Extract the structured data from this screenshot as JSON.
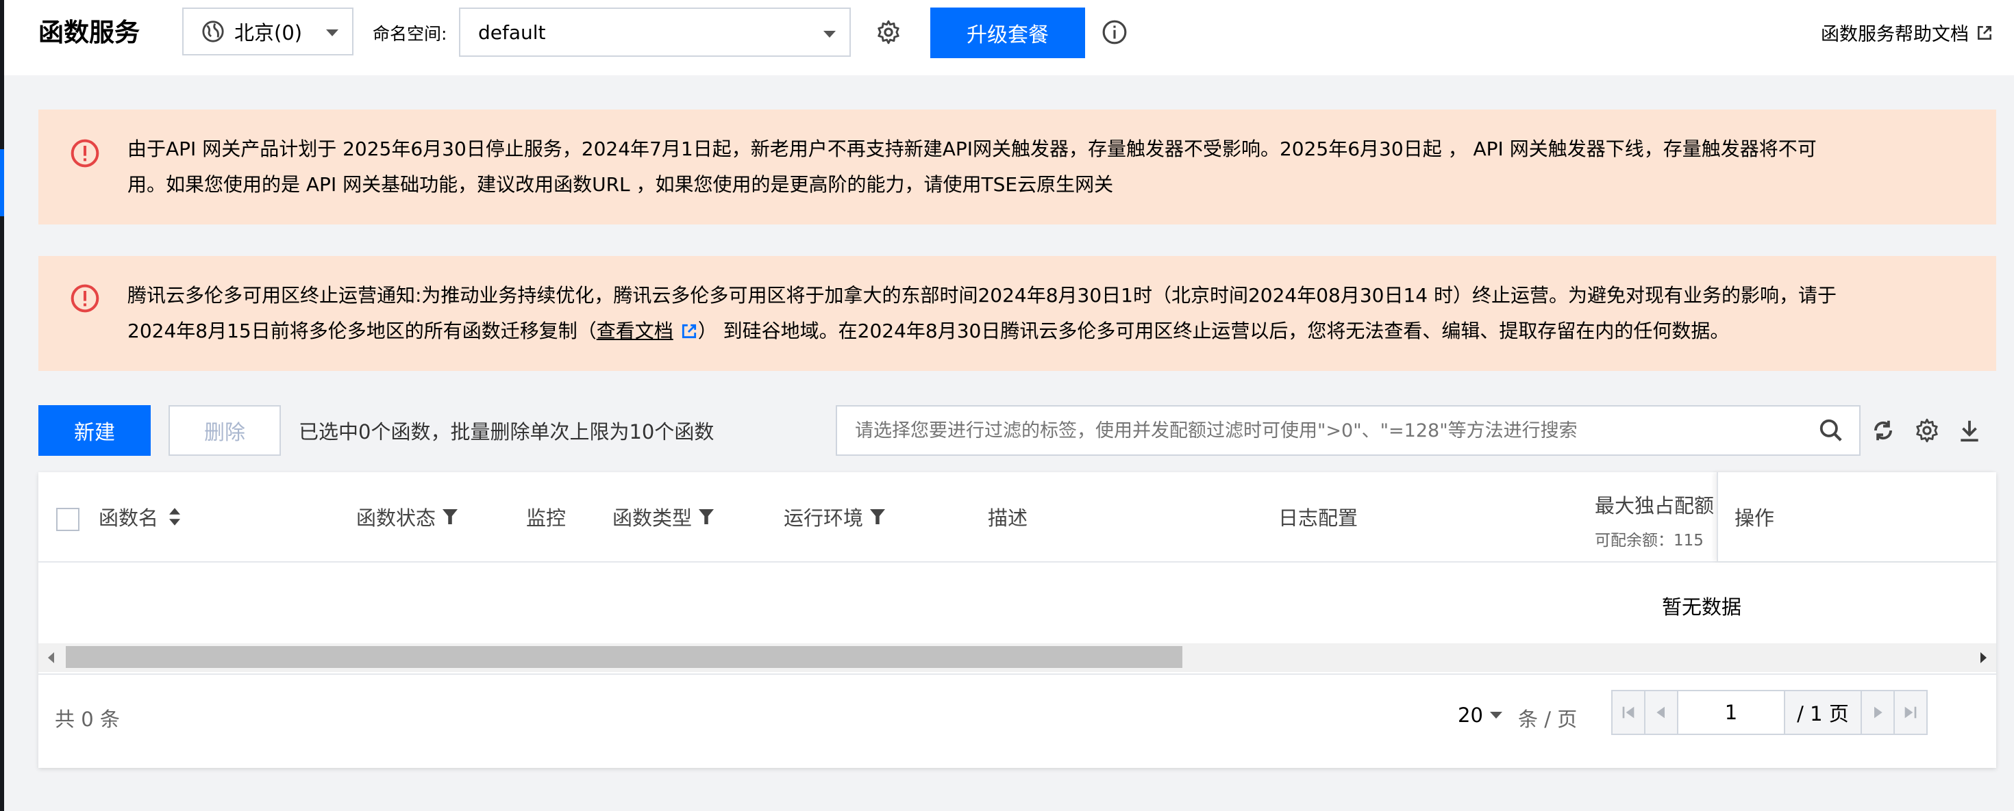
{
  "header": {
    "title": "函数服务",
    "region": "北京(0)",
    "namespace_label": "命名空间:",
    "namespace_value": "default",
    "upgrade_label": "升级套餐",
    "help_link": "函数服务帮助文档"
  },
  "notices": [
    {
      "line1": "由于API 网关产品计划于 2025年6月30日停止服务，2024年7月1日起，新老用户不再支持新建API网关触发器，存量触发器不受影响。2025年6月30日起 ， API 网关触发器下线，存量触发器将不可",
      "line2": "用。如果您使用的是 API 网关基础功能，建议改用函数URL ，如果您使用的是更高阶的能力，请使用TSE云原生网关"
    },
    {
      "line1": "腾讯云多伦多可用区终止运营通知:为推动业务持续优化，腾讯云多伦多可用区将于加拿大的东部时间2024年8月30日1时（北京时间2024年08月30日14 时）终止运营。为避免对现有业务的影响，请于",
      "line2_prefix": "2024年8月15日前将多伦多地区的所有函数迁移复制（",
      "link_text": "查看文档",
      "line2_suffix": "） 到硅谷地域。在2024年8月30日腾讯云多伦多可用区终止运营以后，您将无法查看、编辑、提取存留在内的任何数据。"
    }
  ],
  "toolbar": {
    "new_label": "新建",
    "delete_label": "删除",
    "selection_hint": "已选中0个函数，批量删除单次上限为10个函数",
    "search_placeholder": "请选择您要进行过滤的标签，使用并发配额过滤时可使用\">0\"、\"=128\"等方法进行搜索"
  },
  "table": {
    "columns": {
      "name": "函数名",
      "status": "函数状态",
      "monitor": "监控",
      "type": "函数类型",
      "runtime": "运行环境",
      "desc": "描述",
      "log": "日志配置",
      "quota": "最大独占配额",
      "quota_sub": "可配余额：115",
      "ops": "操作"
    },
    "empty_text": "暂无数据"
  },
  "pagination": {
    "total_text": "共 0 条",
    "page_size": "20",
    "per_page_text": "条 / 页",
    "current_page": "1",
    "total_pages": "/ 1 页"
  },
  "colors": {
    "primary": "#006eff",
    "notice_bg": "#fde4d4",
    "warn": "#e54545"
  }
}
